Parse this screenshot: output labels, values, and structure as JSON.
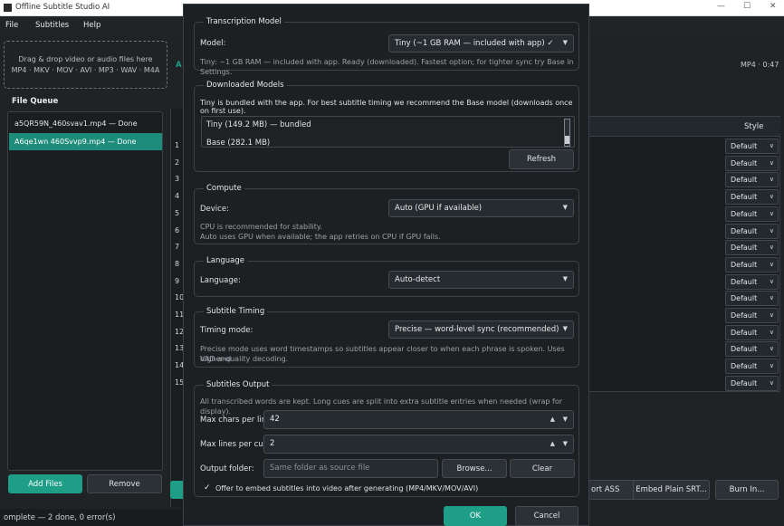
{
  "window": {
    "title": "Offline Subtitle Studio AI",
    "minimize": "—",
    "maximize": "☐",
    "close": "✕"
  },
  "menu": [
    "File",
    "Subtitles",
    "Help"
  ],
  "left": {
    "dropzone": [
      "Drag & drop video or audio files here",
      "MP4 · MKV · MOV · AVI · MP3 · WAV · M4A"
    ],
    "queue_title": "File Queue",
    "queue": [
      {
        "label": "a5QR59N_460svav1.mp4 — Done",
        "selected": false
      },
      {
        "label": "A6qe1wn 460Svvp9.mp4 — Done",
        "selected": true
      }
    ],
    "add_files": "Add Files",
    "remove": "Remove",
    "status": "omplete — 2 done, 0 error(s)"
  },
  "main": {
    "heading_stub": "A",
    "media_info": "MP4 · 0:47",
    "style_header": "Style",
    "style_value": "Default",
    "row_numbers": [
      "1",
      "2",
      "3",
      "4",
      "5",
      "6",
      "7",
      "8",
      "9",
      "10",
      "11",
      "12",
      "13",
      "14",
      "15"
    ],
    "buttons": {
      "export_ass": "ort ASS",
      "embed_plain": "Embed Plain SRT...",
      "burn_in": "Burn In..."
    }
  },
  "dialog": {
    "transcription": {
      "title": "Transcription Model",
      "model_label": "Model:",
      "model_value": "Tiny (~1 GB RAM — included with app) ✓",
      "hint": "Tiny: ~1 GB RAM — included with app. Ready (downloaded). Fastest option; for tighter sync try Base in Settings."
    },
    "downloaded": {
      "title": "Downloaded Models",
      "note": "Tiny is bundled with the app. For best subtitle timing we recommend the Base model (downloads once on first use).",
      "models": [
        "Tiny (149.2 MB) — bundled",
        "Base (282.1 MB)"
      ],
      "refresh": "Refresh"
    },
    "compute": {
      "title": "Compute",
      "device_label": "Device:",
      "device_value": "Auto (GPU if available)",
      "hint1": "CPU is recommended for stability.",
      "hint2": "Auto uses GPU when available; the app retries on CPU if GPU fails."
    },
    "language": {
      "title": "Language",
      "label": "Language:",
      "value": "Auto-detect"
    },
    "timing": {
      "title": "Subtitle Timing",
      "label": "Timing mode:",
      "value": "Precise — word-level sync (recommended)",
      "hint1": "Precise mode uses word timestamps so subtitles appear closer to when each phrase is spoken. Uses VAD and",
      "hint2": "higher-quality decoding."
    },
    "output": {
      "title": "Subtitles  Output",
      "note": "All transcribed words are kept. Long cues are split into extra subtitle entries when needed (wrap for display).",
      "max_chars_label": "Max chars per line:",
      "max_chars": "42",
      "max_lines_label": "Max lines per cue:",
      "max_lines": "2",
      "folder_label": "Output folder:",
      "folder_placeholder": "Same folder as source file",
      "browse": "Browse...",
      "clear": "Clear",
      "check_mark": "✓",
      "embed_offer": "Offer to embed subtitles into video after generating (MP4/MKV/MOV/AVI)"
    },
    "ok": "OK",
    "cancel": "Cancel"
  }
}
